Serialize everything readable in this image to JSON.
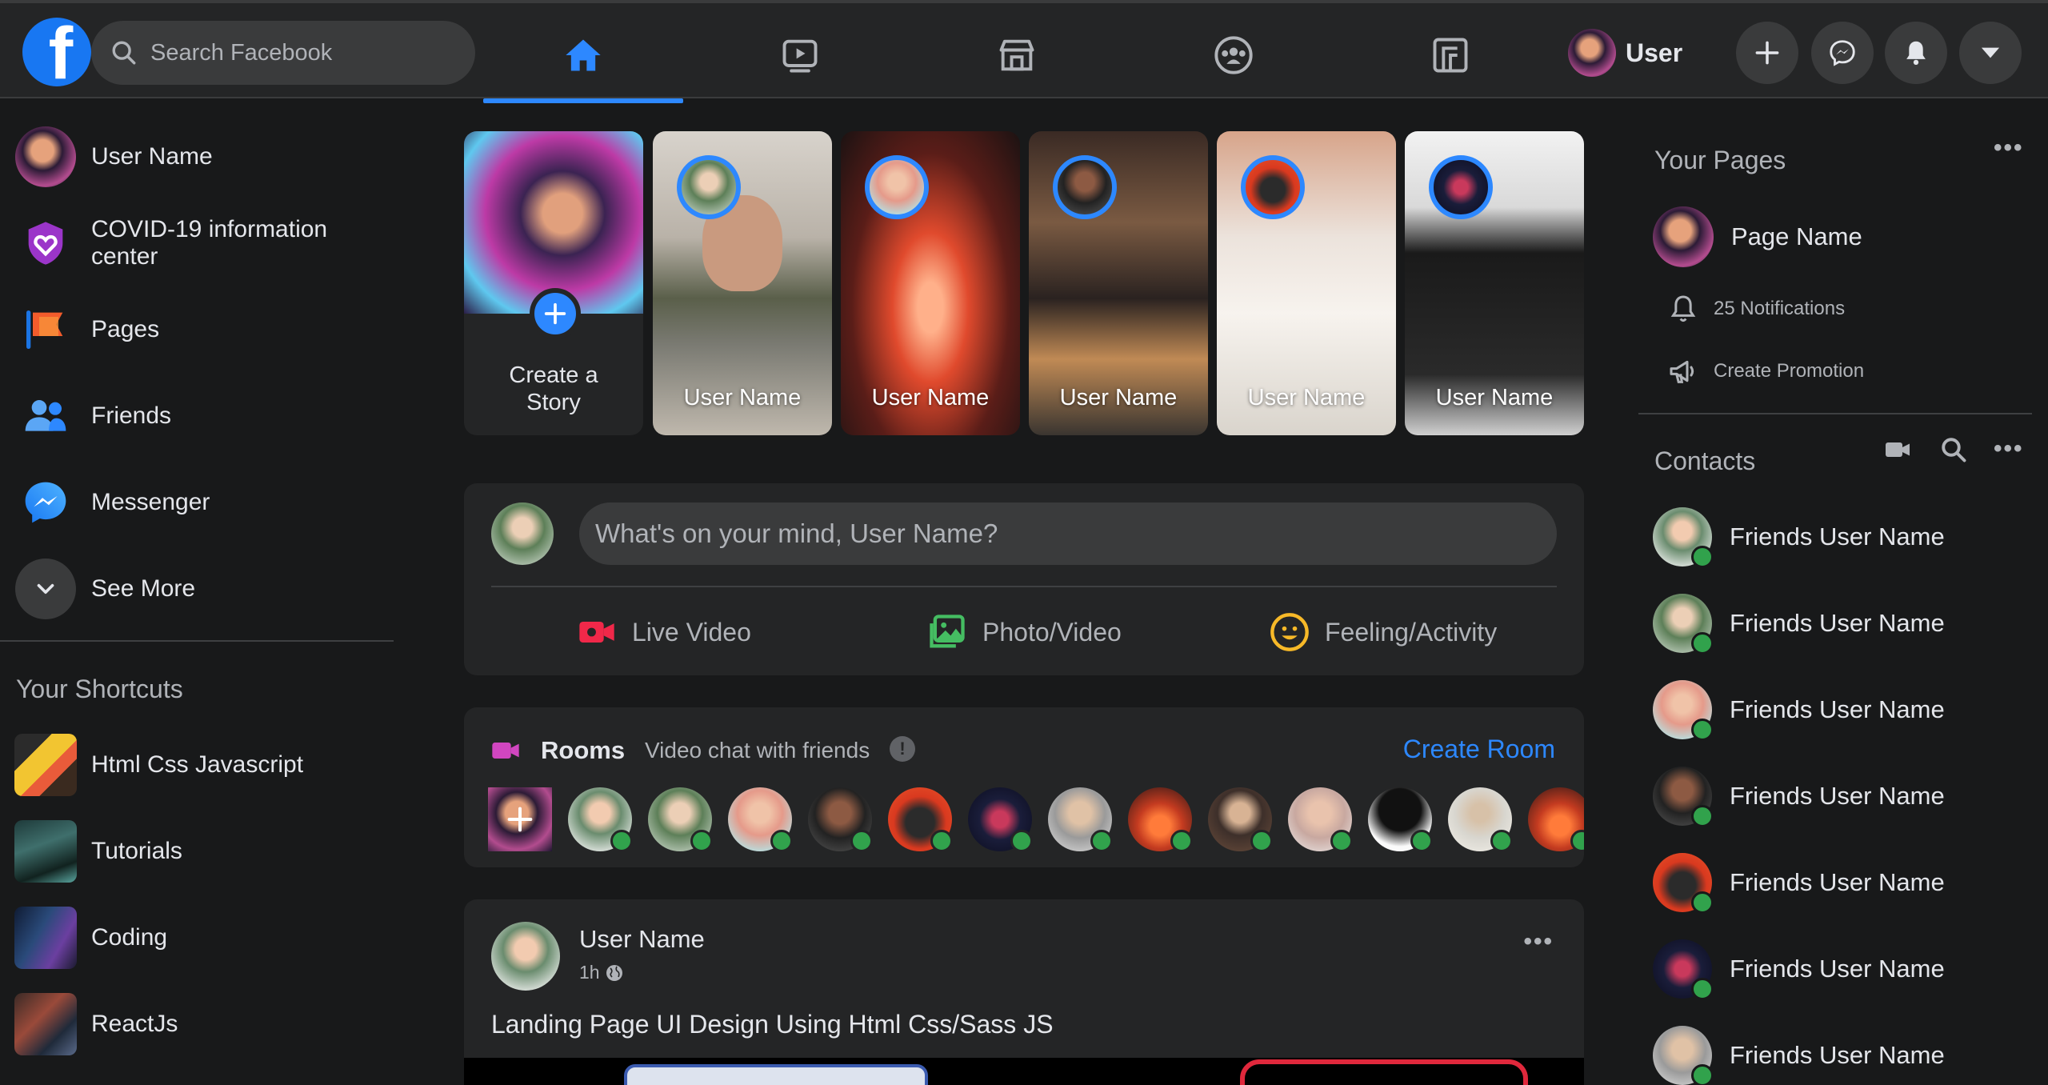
{
  "header": {
    "search_placeholder": "Search Facebook",
    "logo_letter": "f",
    "user_name": "User",
    "nav_tabs": [
      "home",
      "watch",
      "marketplace",
      "groups",
      "gaming"
    ],
    "active_tab": "home"
  },
  "left_sidebar": {
    "items": [
      {
        "label": "User Name",
        "icon": "user-avatar"
      },
      {
        "label": "COVID-19 information center",
        "icon": "covid-heart-icon"
      },
      {
        "label": "Pages",
        "icon": "flag-icon"
      },
      {
        "label": "Friends",
        "icon": "friends-icon"
      },
      {
        "label": "Messenger",
        "icon": "messenger-icon"
      },
      {
        "label": "See More",
        "icon": "chevron-down-icon"
      }
    ],
    "shortcuts_title": "Your Shortcuts",
    "shortcuts": [
      {
        "label": "Html Css Javascript"
      },
      {
        "label": "Tutorials"
      },
      {
        "label": "Coding"
      },
      {
        "label": "ReactJs"
      }
    ]
  },
  "stories": {
    "create_label": "Create a Story",
    "items": [
      {
        "name": "User Name"
      },
      {
        "name": "User Name"
      },
      {
        "name": "User Name"
      },
      {
        "name": "User Name"
      },
      {
        "name": "User Name"
      }
    ]
  },
  "composer": {
    "placeholder": "What's on your mind, User Name?",
    "actions": [
      {
        "label": "Live Video",
        "color": "#f02849"
      },
      {
        "label": "Photo/Video",
        "color": "#45bd62"
      },
      {
        "label": "Feeling/Activity",
        "color": "#f7b928"
      }
    ]
  },
  "rooms": {
    "title": "Rooms",
    "subtitle": "Video chat with friends",
    "create_label": "Create Room"
  },
  "post": {
    "author": "User Name",
    "time": "1h",
    "text": "Landing Page UI Design Using Html Css/Sass JS"
  },
  "right_sidebar": {
    "pages_title": "Your Pages",
    "page_name": "Page Name",
    "notifications": "25 Notifications",
    "create_promotion": "Create Promotion",
    "contacts_title": "Contacts",
    "contacts": [
      {
        "name": "Friends User Name"
      },
      {
        "name": "Friends User Name"
      },
      {
        "name": "Friends User Name"
      },
      {
        "name": "Friends User Name"
      },
      {
        "name": "Friends User Name"
      },
      {
        "name": "Friends User Name"
      },
      {
        "name": "Friends User Name"
      }
    ]
  },
  "colors": {
    "accent": "#2d88ff",
    "background": "#18191a",
    "surface": "#242526",
    "online": "#31a24c"
  }
}
